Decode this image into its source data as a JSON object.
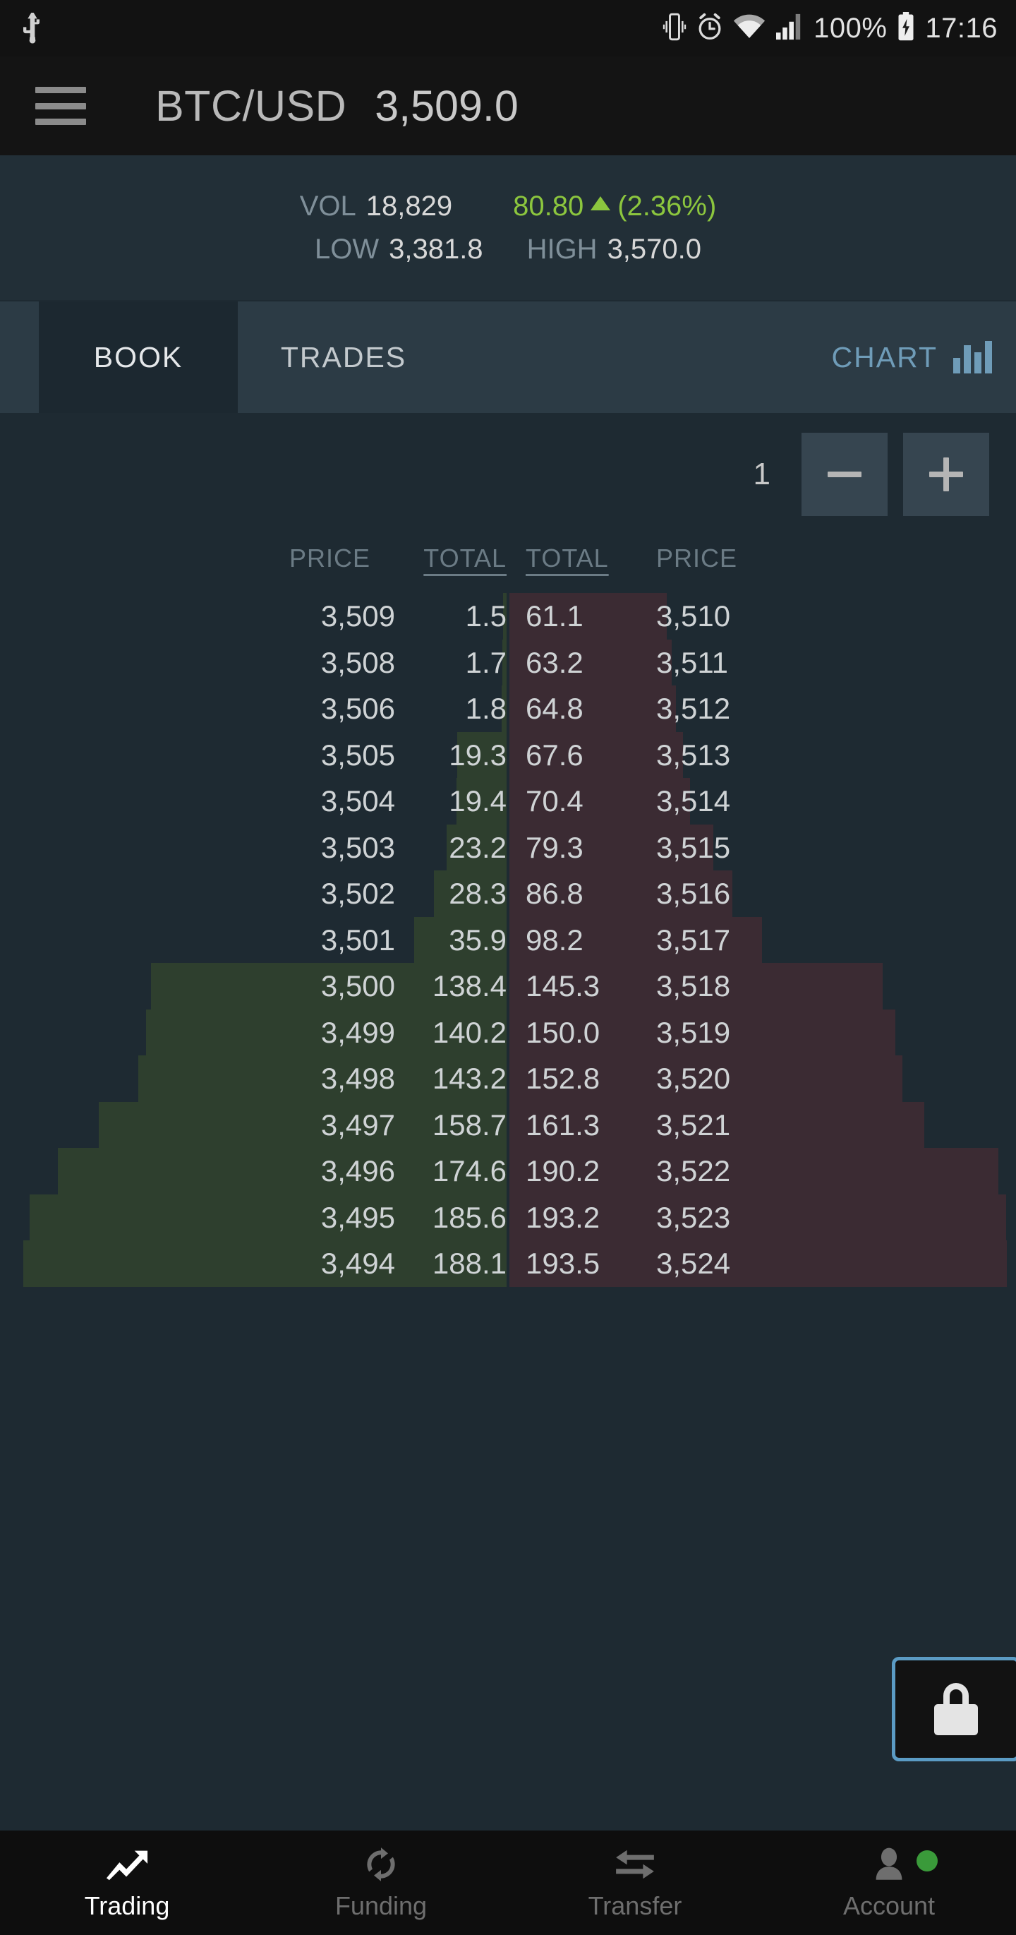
{
  "statusbar": {
    "usb_icon": "usb-icon",
    "vibrate_icon": "vibrate-icon",
    "alarm_icon": "alarm-clock-icon",
    "wifi_icon": "wifi-icon",
    "signal_icon": "cellular-signal-icon",
    "battery_text": "100%",
    "battery_icon": "battery-charging-icon",
    "time": "17:16"
  },
  "header": {
    "menu_icon": "hamburger-menu-icon",
    "pair": "BTC/USD",
    "last_price": "3,509.0"
  },
  "stats": {
    "vol_label": "VOL",
    "vol_value": "18,829",
    "change_value": "80.80",
    "change_direction_icon": "triangle-up-icon",
    "change_percent": "(2.36%)",
    "change_color": "#8cc63e",
    "low_label": "LOW",
    "low_value": "3,381.8",
    "high_label": "HIGH",
    "high_value": "3,570.0"
  },
  "tabs": {
    "book": "BOOK",
    "trades": "TRADES",
    "chart": "CHART",
    "chart_icon": "bar-chart-icon",
    "active": "BOOK"
  },
  "precision": {
    "value": "1",
    "decrease_label": "−",
    "increase_label": "+"
  },
  "orderbook": {
    "headers": {
      "bid_price": "PRICE",
      "bid_total": "TOTAL",
      "ask_total": "TOTAL",
      "ask_price": "PRICE"
    },
    "bid_color": "#2e3f2e",
    "ask_color": "#3b2b33",
    "rows": [
      {
        "bid_price": "3,509",
        "bid_total": "1.5",
        "ask_total": "61.1",
        "ask_price": "3,510"
      },
      {
        "bid_price": "3,508",
        "bid_total": "1.7",
        "ask_total": "63.2",
        "ask_price": "3,511"
      },
      {
        "bid_price": "3,506",
        "bid_total": "1.8",
        "ask_total": "64.8",
        "ask_price": "3,512"
      },
      {
        "bid_price": "3,505",
        "bid_total": "19.3",
        "ask_total": "67.6",
        "ask_price": "3,513"
      },
      {
        "bid_price": "3,504",
        "bid_total": "19.4",
        "ask_total": "70.4",
        "ask_price": "3,514"
      },
      {
        "bid_price": "3,503",
        "bid_total": "23.2",
        "ask_total": "79.3",
        "ask_price": "3,515"
      },
      {
        "bid_price": "3,502",
        "bid_total": "28.3",
        "ask_total": "86.8",
        "ask_price": "3,516"
      },
      {
        "bid_price": "3,501",
        "bid_total": "35.9",
        "ask_total": "98.2",
        "ask_price": "3,517"
      },
      {
        "bid_price": "3,500",
        "bid_total": "138.4",
        "ask_total": "145.3",
        "ask_price": "3,518"
      },
      {
        "bid_price": "3,499",
        "bid_total": "140.2",
        "ask_total": "150.0",
        "ask_price": "3,519"
      },
      {
        "bid_price": "3,498",
        "bid_total": "143.2",
        "ask_total": "152.8",
        "ask_price": "3,520"
      },
      {
        "bid_price": "3,497",
        "bid_total": "158.7",
        "ask_total": "161.3",
        "ask_price": "3,521"
      },
      {
        "bid_price": "3,496",
        "bid_total": "174.6",
        "ask_total": "190.2",
        "ask_price": "3,522"
      },
      {
        "bid_price": "3,495",
        "bid_total": "185.6",
        "ask_total": "193.2",
        "ask_price": "3,523"
      },
      {
        "bid_price": "3,494",
        "bid_total": "188.1",
        "ask_total": "193.5",
        "ask_price": "3,524"
      }
    ]
  },
  "lock": {
    "icon": "padlock-closed-icon",
    "border_color": "#5b9bc4"
  },
  "bottomnav": {
    "items": [
      {
        "label": "Trading",
        "icon": "trending-up-icon",
        "active": true
      },
      {
        "label": "Funding",
        "icon": "sync-refresh-icon",
        "active": false
      },
      {
        "label": "Transfer",
        "icon": "transfer-arrows-icon",
        "active": false
      },
      {
        "label": "Account",
        "icon": "person-icon",
        "active": false,
        "status_dot_color": "#3a9a3a"
      }
    ]
  }
}
